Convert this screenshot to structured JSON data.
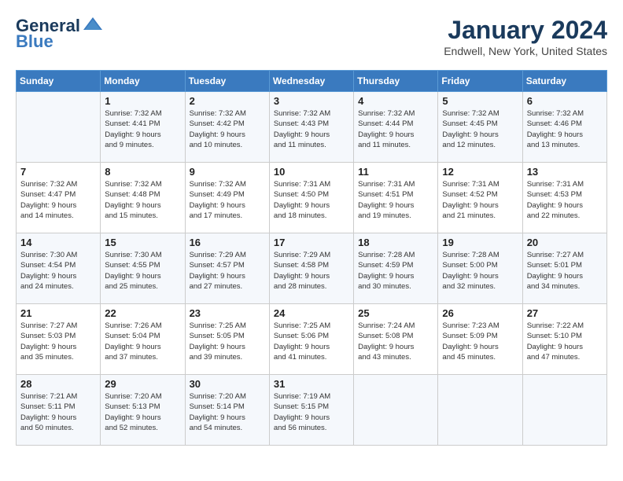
{
  "header": {
    "logo_line1": "General",
    "logo_line2": "Blue",
    "calendar_title": "January 2024",
    "calendar_subtitle": "Endwell, New York, United States"
  },
  "days_of_week": [
    "Sunday",
    "Monday",
    "Tuesday",
    "Wednesday",
    "Thursday",
    "Friday",
    "Saturday"
  ],
  "weeks": [
    [
      {
        "day": "",
        "info": ""
      },
      {
        "day": "1",
        "info": "Sunrise: 7:32 AM\nSunset: 4:41 PM\nDaylight: 9 hours\nand 9 minutes."
      },
      {
        "day": "2",
        "info": "Sunrise: 7:32 AM\nSunset: 4:42 PM\nDaylight: 9 hours\nand 10 minutes."
      },
      {
        "day": "3",
        "info": "Sunrise: 7:32 AM\nSunset: 4:43 PM\nDaylight: 9 hours\nand 11 minutes."
      },
      {
        "day": "4",
        "info": "Sunrise: 7:32 AM\nSunset: 4:44 PM\nDaylight: 9 hours\nand 11 minutes."
      },
      {
        "day": "5",
        "info": "Sunrise: 7:32 AM\nSunset: 4:45 PM\nDaylight: 9 hours\nand 12 minutes."
      },
      {
        "day": "6",
        "info": "Sunrise: 7:32 AM\nSunset: 4:46 PM\nDaylight: 9 hours\nand 13 minutes."
      }
    ],
    [
      {
        "day": "7",
        "info": "Sunrise: 7:32 AM\nSunset: 4:47 PM\nDaylight: 9 hours\nand 14 minutes."
      },
      {
        "day": "8",
        "info": "Sunrise: 7:32 AM\nSunset: 4:48 PM\nDaylight: 9 hours\nand 15 minutes."
      },
      {
        "day": "9",
        "info": "Sunrise: 7:32 AM\nSunset: 4:49 PM\nDaylight: 9 hours\nand 17 minutes."
      },
      {
        "day": "10",
        "info": "Sunrise: 7:31 AM\nSunset: 4:50 PM\nDaylight: 9 hours\nand 18 minutes."
      },
      {
        "day": "11",
        "info": "Sunrise: 7:31 AM\nSunset: 4:51 PM\nDaylight: 9 hours\nand 19 minutes."
      },
      {
        "day": "12",
        "info": "Sunrise: 7:31 AM\nSunset: 4:52 PM\nDaylight: 9 hours\nand 21 minutes."
      },
      {
        "day": "13",
        "info": "Sunrise: 7:31 AM\nSunset: 4:53 PM\nDaylight: 9 hours\nand 22 minutes."
      }
    ],
    [
      {
        "day": "14",
        "info": "Sunrise: 7:30 AM\nSunset: 4:54 PM\nDaylight: 9 hours\nand 24 minutes."
      },
      {
        "day": "15",
        "info": "Sunrise: 7:30 AM\nSunset: 4:55 PM\nDaylight: 9 hours\nand 25 minutes."
      },
      {
        "day": "16",
        "info": "Sunrise: 7:29 AM\nSunset: 4:57 PM\nDaylight: 9 hours\nand 27 minutes."
      },
      {
        "day": "17",
        "info": "Sunrise: 7:29 AM\nSunset: 4:58 PM\nDaylight: 9 hours\nand 28 minutes."
      },
      {
        "day": "18",
        "info": "Sunrise: 7:28 AM\nSunset: 4:59 PM\nDaylight: 9 hours\nand 30 minutes."
      },
      {
        "day": "19",
        "info": "Sunrise: 7:28 AM\nSunset: 5:00 PM\nDaylight: 9 hours\nand 32 minutes."
      },
      {
        "day": "20",
        "info": "Sunrise: 7:27 AM\nSunset: 5:01 PM\nDaylight: 9 hours\nand 34 minutes."
      }
    ],
    [
      {
        "day": "21",
        "info": "Sunrise: 7:27 AM\nSunset: 5:03 PM\nDaylight: 9 hours\nand 35 minutes."
      },
      {
        "day": "22",
        "info": "Sunrise: 7:26 AM\nSunset: 5:04 PM\nDaylight: 9 hours\nand 37 minutes."
      },
      {
        "day": "23",
        "info": "Sunrise: 7:25 AM\nSunset: 5:05 PM\nDaylight: 9 hours\nand 39 minutes."
      },
      {
        "day": "24",
        "info": "Sunrise: 7:25 AM\nSunset: 5:06 PM\nDaylight: 9 hours\nand 41 minutes."
      },
      {
        "day": "25",
        "info": "Sunrise: 7:24 AM\nSunset: 5:08 PM\nDaylight: 9 hours\nand 43 minutes."
      },
      {
        "day": "26",
        "info": "Sunrise: 7:23 AM\nSunset: 5:09 PM\nDaylight: 9 hours\nand 45 minutes."
      },
      {
        "day": "27",
        "info": "Sunrise: 7:22 AM\nSunset: 5:10 PM\nDaylight: 9 hours\nand 47 minutes."
      }
    ],
    [
      {
        "day": "28",
        "info": "Sunrise: 7:21 AM\nSunset: 5:11 PM\nDaylight: 9 hours\nand 50 minutes."
      },
      {
        "day": "29",
        "info": "Sunrise: 7:20 AM\nSunset: 5:13 PM\nDaylight: 9 hours\nand 52 minutes."
      },
      {
        "day": "30",
        "info": "Sunrise: 7:20 AM\nSunset: 5:14 PM\nDaylight: 9 hours\nand 54 minutes."
      },
      {
        "day": "31",
        "info": "Sunrise: 7:19 AM\nSunset: 5:15 PM\nDaylight: 9 hours\nand 56 minutes."
      },
      {
        "day": "",
        "info": ""
      },
      {
        "day": "",
        "info": ""
      },
      {
        "day": "",
        "info": ""
      }
    ]
  ]
}
